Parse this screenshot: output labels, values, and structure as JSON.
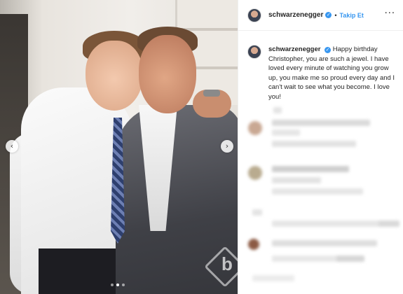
{
  "post": {
    "username": "schwarzenegger",
    "verified_icon": "verified-badge-icon",
    "separator": "•",
    "follow_label": "Takip Et",
    "more_icon": "···"
  },
  "caption": {
    "username": "schwarzenegger",
    "text": "Happy birthday Christopher, you are such a jewel. I have loved every minute of watching you grow up, you make me so proud every day and I can't wait to see what you become. I love you!"
  },
  "carousel": {
    "prev_icon": "‹",
    "next_icon": "›",
    "slide_count": 3,
    "active_slide": 2
  },
  "watermark": {
    "letter": "b"
  },
  "colors": {
    "link": "#3897f0",
    "text": "#262626",
    "border": "#efefef"
  }
}
